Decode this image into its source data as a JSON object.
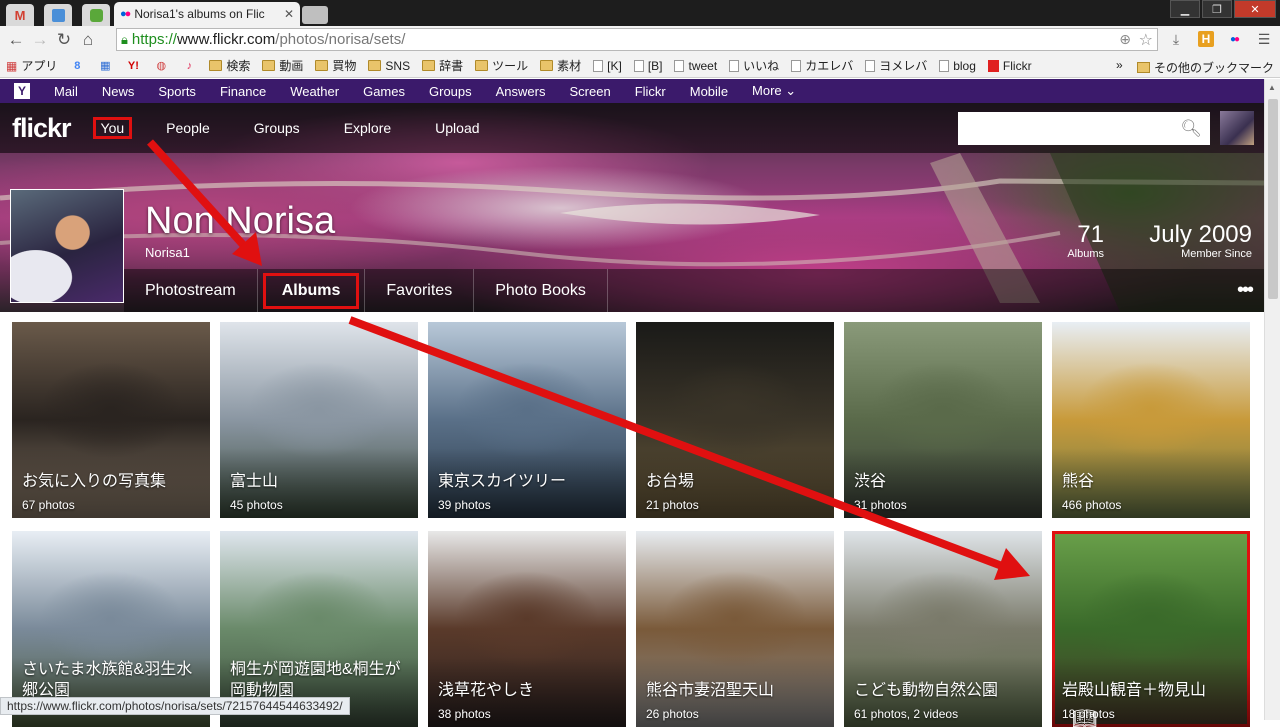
{
  "browser": {
    "tab_title": "Norisa1's albums on Flic",
    "url_https": "https://",
    "url_host": "www.flickr.com",
    "url_path": "/photos/norisa/sets/",
    "status_url": "https://www.flickr.com/photos/norisa/sets/72157644544633492/",
    "bookmarks": [
      {
        "label": "アプリ",
        "type": "apps"
      },
      {
        "label": "",
        "type": "favicon",
        "color": "#4285f4",
        "glyph": "8"
      },
      {
        "label": "",
        "type": "favicon",
        "color": "#2a6bd4",
        "glyph": "▦"
      },
      {
        "label": "",
        "type": "favicon",
        "color": "#d00000",
        "glyph": "Y!"
      },
      {
        "label": "",
        "type": "favicon",
        "color": "#d04040",
        "glyph": "◍"
      },
      {
        "label": "",
        "type": "favicon",
        "color": "#e0305a",
        "glyph": "♪"
      },
      {
        "label": "検索",
        "type": "folder"
      },
      {
        "label": "動画",
        "type": "folder"
      },
      {
        "label": "買物",
        "type": "folder"
      },
      {
        "label": "SNS",
        "type": "folder"
      },
      {
        "label": "辞書",
        "type": "folder"
      },
      {
        "label": "ツール",
        "type": "folder"
      },
      {
        "label": "素材",
        "type": "folder"
      },
      {
        "label": "[K]",
        "type": "page"
      },
      {
        "label": "[B]",
        "type": "page"
      },
      {
        "label": "tweet",
        "type": "page"
      },
      {
        "label": "いいね",
        "type": "page"
      },
      {
        "label": "カエレバ",
        "type": "page"
      },
      {
        "label": "ヨメレバ",
        "type": "page"
      },
      {
        "label": "blog",
        "type": "page"
      },
      {
        "label": "Flickr",
        "type": "flickr"
      }
    ],
    "bookmarks_overflow": "»",
    "other_bookmarks": "その他のブックマーク"
  },
  "yahoo_bar": {
    "logo": "Y",
    "items": [
      "Mail",
      "News",
      "Sports",
      "Finance",
      "Weather",
      "Games",
      "Groups",
      "Answers",
      "Screen",
      "Flickr",
      "Mobile",
      "More ⌄"
    ]
  },
  "flickr": {
    "logo": "flickr",
    "nav": [
      "You",
      "People",
      "Groups",
      "Explore",
      "Upload"
    ],
    "profile_name": "Non Norisa",
    "username": "Norisa1",
    "albums_count": "71",
    "albums_label": "Albums",
    "member_since": "July 2009",
    "member_since_label": "Member Since",
    "subnav": [
      "Photostream",
      "Albums",
      "Favorites",
      "Photo Books"
    ],
    "more": "•••"
  },
  "albums": [
    {
      "title": "お気に入りの写真集",
      "count": "67 photos",
      "colors": [
        "#6a5a4a",
        "#2a2420",
        "#8a7a68"
      ]
    },
    {
      "title": "富士山",
      "count": "45 photos",
      "colors": [
        "#dfe4ea",
        "#8a96a2",
        "#3a4a3a"
      ]
    },
    {
      "title": "東京スカイツリー",
      "count": "39 photos",
      "colors": [
        "#b8c8d8",
        "#5a7088",
        "#2a3a4a"
      ]
    },
    {
      "title": "お台場",
      "count": "21 photos",
      "colors": [
        "#1a1a18",
        "#3a3428",
        "#6a5a3a"
      ]
    },
    {
      "title": "渋谷",
      "count": "31 photos",
      "colors": [
        "#8a9a7a",
        "#5a6a4a",
        "#3a4038"
      ]
    },
    {
      "title": "熊谷",
      "count": "466 photos",
      "colors": [
        "#e8eef4",
        "#c89a3a",
        "#6a7a4a"
      ]
    },
    {
      "title": "さいたま水族館&羽生水郷公園",
      "count": "",
      "colors": [
        "#e8eef4",
        "#7a8a9a",
        "#4a5a3a"
      ]
    },
    {
      "title": "桐生が岡遊園地&桐生が 岡動物園",
      "count": "",
      "colors": [
        "#dfe6ee",
        "#6a8a6a",
        "#3a4a3a"
      ]
    },
    {
      "title": "浅草花やしき",
      "count": "38 photos",
      "colors": [
        "#e8e8e8",
        "#5a3a2a",
        "#2a2020"
      ]
    },
    {
      "title": "熊谷市妻沼聖天山",
      "count": "26 photos",
      "colors": [
        "#e8ecf0",
        "#7a5a3a",
        "#8a8a8a"
      ]
    },
    {
      "title": "こども動物自然公園",
      "count": "61 photos, 2 videos",
      "colors": [
        "#dfe4e8",
        "#7a7a6a",
        "#5a6a4a"
      ]
    },
    {
      "title": "岩殿山観音＋物見山",
      "count": "18 photos",
      "colors": [
        "#6aa04a",
        "#3a6a2a",
        "#4a3a2a"
      ]
    }
  ],
  "albums_count_visible_overlap": "",
  "annotation_color": "#e01010"
}
